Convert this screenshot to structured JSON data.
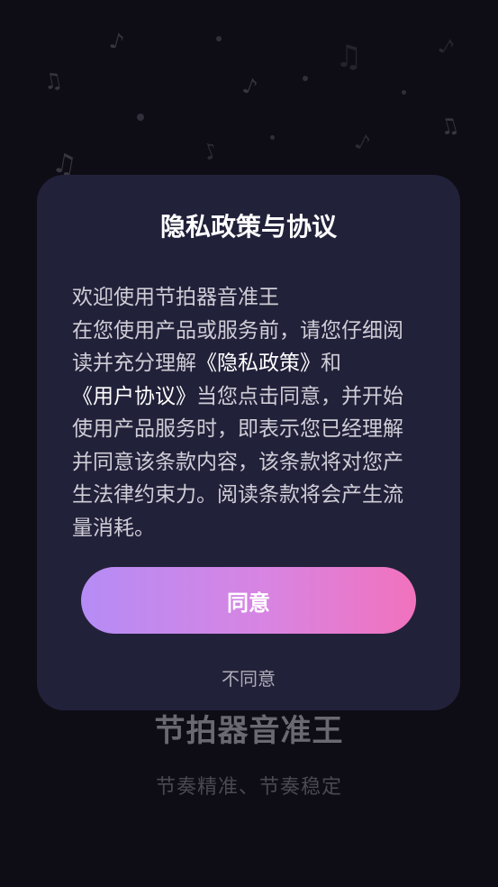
{
  "background": {
    "app_title": "节拍器音准王",
    "tagline": "节奏精准、节奏稳定",
    "note_icon": "music-note-icon"
  },
  "dialog": {
    "title": "隐私政策与协议",
    "intro_line": "欢迎使用节拍器音准王",
    "body_part1": "在您使用产品或服务前，请您仔细阅读并充分理解",
    "privacy_link": "《隐私政策》",
    "body_and": "和",
    "user_agreement_link": "《用户协议》",
    "body_part2": "当您点击同意，并开始使用产品服务时，即表示您已经理解并同意该条款内容，该条款将对您产生法律约束力。阅读条款将会产生流量消耗。",
    "agree_label": "同意",
    "disagree_label": "不同意"
  },
  "colors": {
    "dialog_bg": "#22213a",
    "button_gradient_start": "#b58cf5",
    "button_gradient_end": "#f172bd"
  }
}
